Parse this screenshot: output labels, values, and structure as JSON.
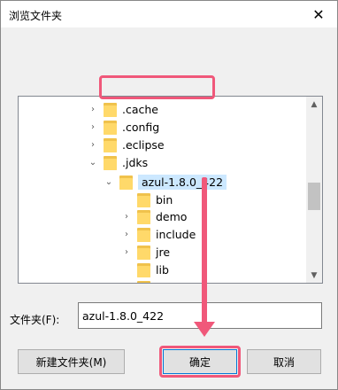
{
  "dialog": {
    "title": "浏览文件夹",
    "close_glyph": "✕"
  },
  "tree": {
    "rows": [
      {
        "label": ".cache",
        "expand": "›"
      },
      {
        "label": ".config",
        "expand": "›"
      },
      {
        "label": ".eclipse",
        "expand": "›"
      },
      {
        "label": ".jdks",
        "expand": "⌄"
      },
      {
        "label": "azul-1.8.0_422",
        "expand": "⌄"
      },
      {
        "label": "bin",
        "expand": ""
      },
      {
        "label": "demo",
        "expand": "›"
      },
      {
        "label": "include",
        "expand": "›"
      },
      {
        "label": "jre",
        "expand": "›"
      },
      {
        "label": "lib",
        "expand": ""
      }
    ],
    "scroll_up": "▲",
    "scroll_down": "▼"
  },
  "folder_field": {
    "label": "文件夹(F):",
    "value": "azul-1.8.0_422"
  },
  "buttons": {
    "new_folder": "新建文件夹(M)",
    "ok": "确定",
    "cancel": "取消"
  },
  "colors": {
    "highlight": "#f0587a",
    "selection": "#cce8ff",
    "folder": "#ffd96a"
  }
}
